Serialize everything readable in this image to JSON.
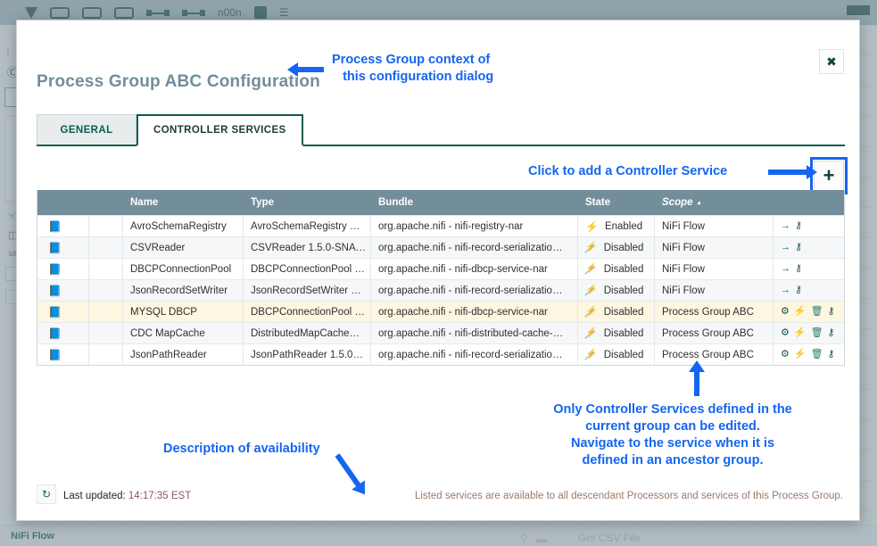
{
  "background": {
    "toolbar_icons": [
      "processor-icon",
      "input-port-icon",
      "output-port-icon",
      "process-group-icon",
      "remote-process-group-icon",
      "funnel-icon",
      "template-icon",
      "label-icon"
    ],
    "status_breadcrumb": "NiFi Flow",
    "canvas_processor_name": "Get CSV File",
    "rail_label": "b8"
  },
  "dialog": {
    "title": "Process Group ABC Configuration",
    "close_icon": "close-icon",
    "close_label": "✖",
    "tabs": [
      {
        "label": "GENERAL",
        "active": false
      },
      {
        "label": "CONTROLLER SERVICES",
        "active": true
      }
    ],
    "add_button": {
      "icon": "plus-icon",
      "label": "+"
    },
    "refresh_button": {
      "icon": "refresh-icon",
      "label": "↻"
    },
    "last_updated_label": "Last updated:",
    "last_updated_time": "14:17:35 EST",
    "availability_note": "Listed services are available to all descendant Processors and services of this Process Group."
  },
  "table": {
    "columns": [
      "",
      "",
      "Name",
      "Type",
      "Bundle",
      "State",
      "Scope"
    ],
    "sort_column": "Scope",
    "sort_caret": "▴",
    "rows": [
      {
        "icon": "controller-service-icon",
        "name": "AvroSchemaRegistry",
        "type": "AvroSchemaRegistry …",
        "bundle": "org.apache.nifi - nifi-registry-nar",
        "state": "Enabled",
        "state_icon": "bolt-enabled-icon",
        "scope": "NiFi Flow",
        "highlight": false,
        "actions": [
          {
            "icon": "go-to-icon",
            "label": "→"
          },
          {
            "icon": "key-icon",
            "label": "⚷"
          }
        ]
      },
      {
        "icon": "controller-service-icon",
        "name": "CSVReader",
        "type": "CSVReader 1.5.0-SNA…",
        "bundle": "org.apache.nifi - nifi-record-serializatio…",
        "state": "Disabled",
        "state_icon": "bolt-disabled-icon",
        "scope": "NiFi Flow",
        "highlight": false,
        "actions": [
          {
            "icon": "go-to-icon",
            "label": "→"
          },
          {
            "icon": "key-icon",
            "label": "⚷"
          }
        ]
      },
      {
        "icon": "controller-service-icon",
        "name": "DBCPConnectionPool",
        "type": "DBCPConnectionPool …",
        "bundle": "org.apache.nifi - nifi-dbcp-service-nar",
        "state": "Disabled",
        "state_icon": "bolt-disabled-icon",
        "scope": "NiFi Flow",
        "highlight": false,
        "actions": [
          {
            "icon": "go-to-icon",
            "label": "→"
          },
          {
            "icon": "key-icon",
            "label": "⚷"
          }
        ]
      },
      {
        "icon": "controller-service-icon",
        "name": "JsonRecordSetWriter",
        "type": "JsonRecordSetWriter …",
        "bundle": "org.apache.nifi - nifi-record-serializatio…",
        "state": "Disabled",
        "state_icon": "bolt-disabled-icon",
        "scope": "NiFi Flow",
        "highlight": false,
        "actions": [
          {
            "icon": "go-to-icon",
            "label": "→"
          },
          {
            "icon": "key-icon",
            "label": "⚷"
          }
        ]
      },
      {
        "icon": "controller-service-icon",
        "name": "MYSQL DBCP",
        "type": "DBCPConnectionPool …",
        "bundle": "org.apache.nifi - nifi-dbcp-service-nar",
        "state": "Disabled",
        "state_icon": "bolt-disabled-icon",
        "scope": "Process Group ABC",
        "highlight": true,
        "actions": [
          {
            "icon": "gear-icon",
            "label": "⚙"
          },
          {
            "icon": "enable-bolt-icon",
            "label": "⚡"
          },
          {
            "icon": "trash-icon",
            "label": "🗑"
          },
          {
            "icon": "key-icon",
            "label": "⚷"
          }
        ]
      },
      {
        "icon": "controller-service-icon",
        "name": "CDC MapCache",
        "type": "DistributedMapCache…",
        "bundle": "org.apache.nifi - nifi-distributed-cache-…",
        "state": "Disabled",
        "state_icon": "bolt-disabled-icon",
        "scope": "Process Group ABC",
        "highlight": false,
        "actions": [
          {
            "icon": "gear-icon",
            "label": "⚙"
          },
          {
            "icon": "enable-bolt-icon",
            "label": "⚡"
          },
          {
            "icon": "trash-icon",
            "label": "🗑"
          },
          {
            "icon": "key-icon",
            "label": "⚷"
          }
        ]
      },
      {
        "icon": "controller-service-icon",
        "name": "JsonPathReader",
        "type": "JsonPathReader 1.5.0…",
        "bundle": "org.apache.nifi - nifi-record-serializatio…",
        "state": "Disabled",
        "state_icon": "bolt-disabled-icon",
        "scope": "Process Group ABC",
        "highlight": false,
        "actions": [
          {
            "icon": "gear-icon",
            "label": "⚙"
          },
          {
            "icon": "enable-bolt-icon",
            "label": "⚡"
          },
          {
            "icon": "trash-icon",
            "label": "🗑"
          },
          {
            "icon": "key-icon",
            "label": "⚷"
          }
        ]
      }
    ]
  },
  "annotations": {
    "title_note": "Process Group context of\n   this configuration dialog",
    "add_note": "Click to add a Controller Service",
    "scope_note": "Only Controller Services defined in the\ncurrent group can be edited.\nNavigate to the service when it is\ndefined in an ancestor group.",
    "description_note": "Description of availability"
  },
  "colors": {
    "annotation_blue": "#1565f0",
    "table_header": "#728e9b",
    "accent_teal": "#0d5c50",
    "highlight_row": "#fdf6e0",
    "enabled_bolt": "#2a8fd4",
    "disabled_bolt": "#8fa9b5",
    "timestamp": "#8b5a58",
    "note_text": "#9a7a6b"
  }
}
